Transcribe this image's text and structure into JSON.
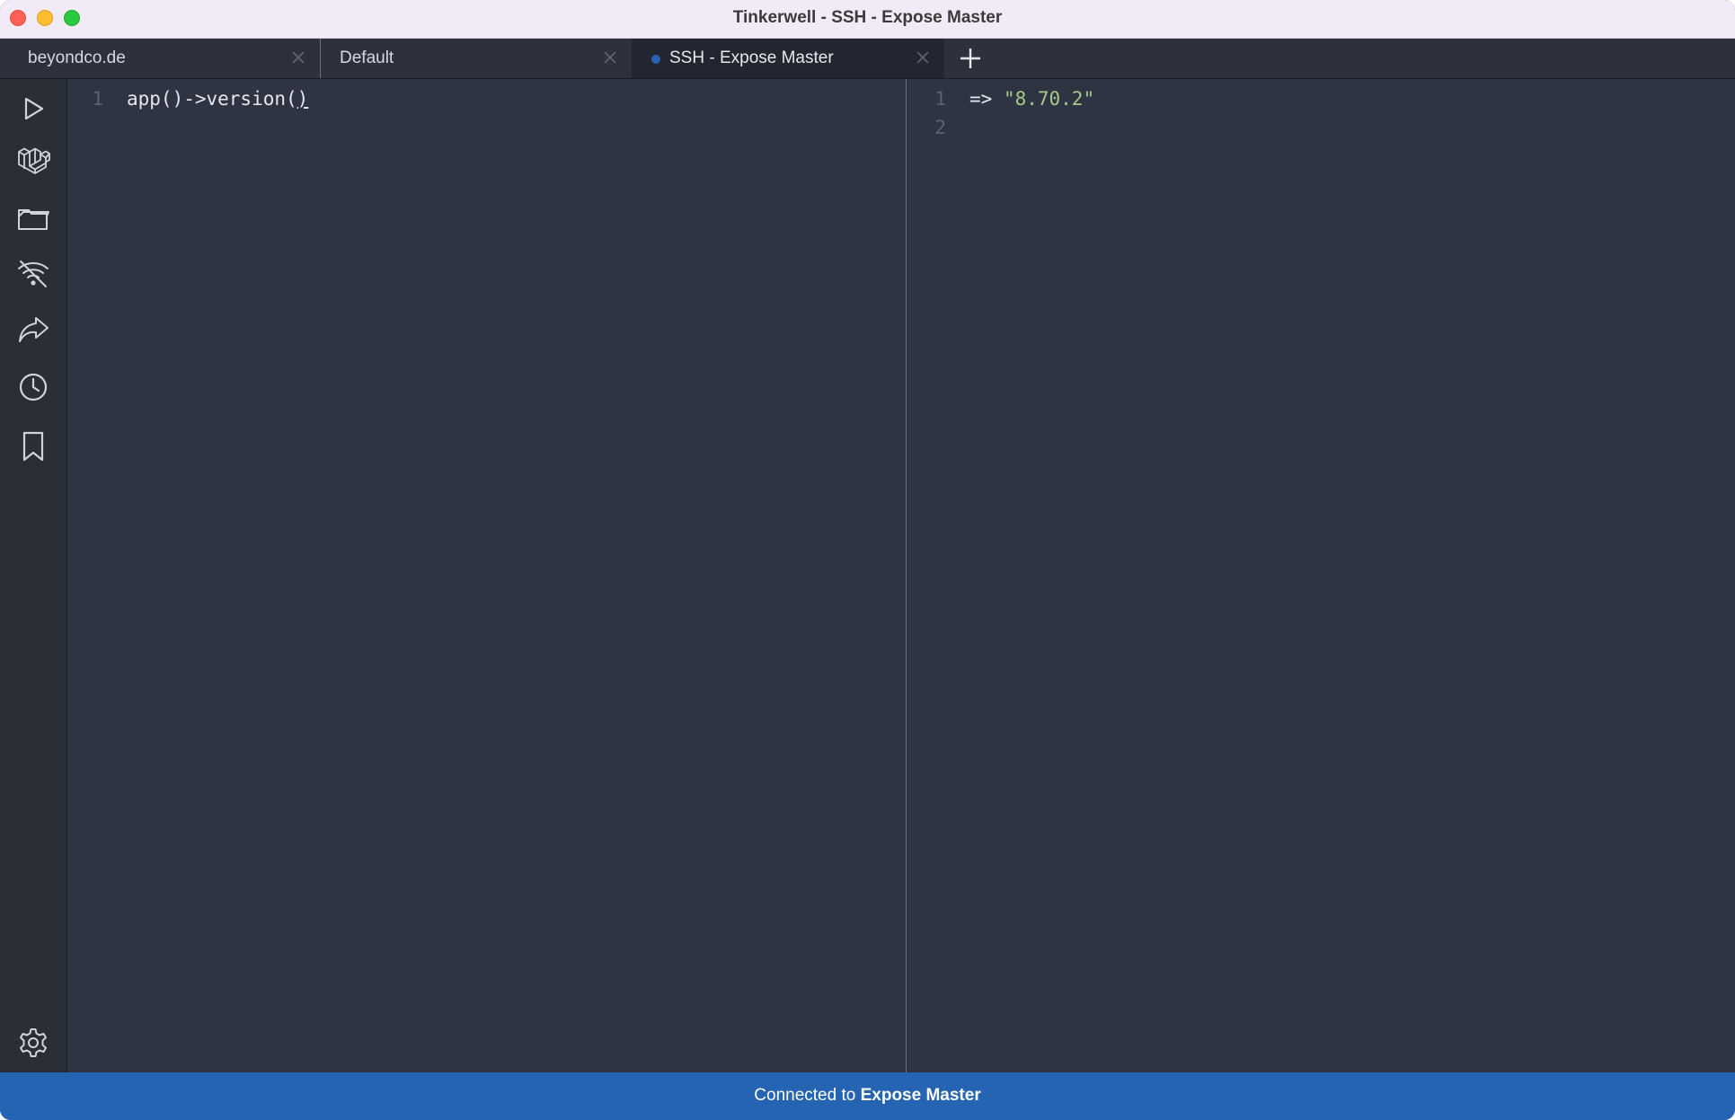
{
  "window": {
    "title": "Tinkerwell - SSH - Expose Master"
  },
  "tabs": [
    {
      "label": "beyondco.de",
      "active": false
    },
    {
      "label": "Default",
      "active": false
    },
    {
      "label": "SSH - Expose Master",
      "active": true
    }
  ],
  "sidebar": {
    "icons": [
      "run-icon",
      "laravel-icon",
      "folder-icon",
      "wifi-off-icon",
      "share-icon",
      "history-icon",
      "bookmark-icon"
    ],
    "bottom_icon": "settings-icon"
  },
  "editor": {
    "lines": [
      {
        "number": "1",
        "code_before": "app()->version(",
        "code_after": ")"
      }
    ]
  },
  "output": {
    "lines": [
      {
        "number": "1",
        "operator": "=>",
        "value": "\"8.70.2\""
      },
      {
        "number": "2",
        "operator": "",
        "value": ""
      }
    ]
  },
  "status": {
    "prefix": "Connected to",
    "connection": "Expose Master"
  },
  "colors": {
    "status_bar": "#2563b3",
    "editor_bg": "#2e3442",
    "string": "#a5c98a",
    "active_tab_dot": "#2a63b5"
  }
}
